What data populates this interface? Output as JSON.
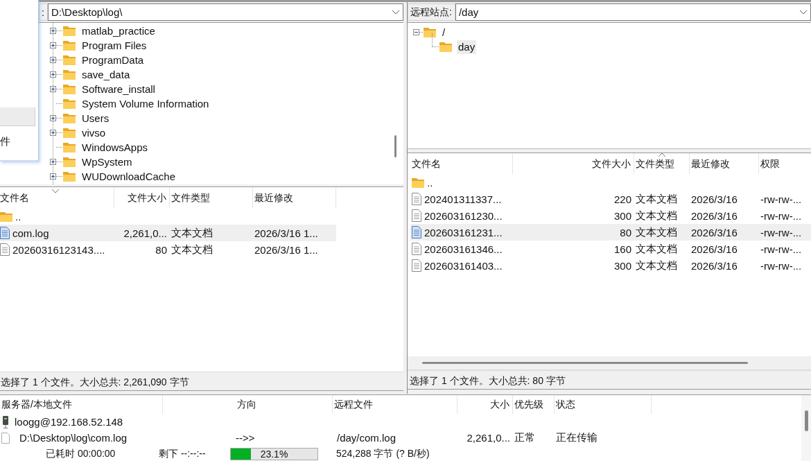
{
  "overlay_window": {
    "text": "件"
  },
  "local": {
    "path_label": ":",
    "path": "D:\\Desktop\\log\\",
    "tree": [
      {
        "name": "matlab_practice",
        "expandable": true
      },
      {
        "name": "Program Files",
        "expandable": true
      },
      {
        "name": "ProgramData",
        "expandable": true
      },
      {
        "name": "save_data",
        "expandable": true
      },
      {
        "name": "Software_install",
        "expandable": true
      },
      {
        "name": "System Volume Information",
        "expandable": false
      },
      {
        "name": "Users",
        "expandable": true
      },
      {
        "name": "vivso",
        "expandable": true
      },
      {
        "name": "WindowsApps",
        "expandable": false
      },
      {
        "name": "WpSystem",
        "expandable": true
      },
      {
        "name": "WUDownloadCache",
        "expandable": true
      }
    ],
    "sort_ascending": false,
    "columns": [
      {
        "label": "文件名",
        "sorted": true
      },
      {
        "label": "文件大小",
        "sorted": false
      },
      {
        "label": "文件类型",
        "sorted": false
      },
      {
        "label": "最近修改",
        "sorted": false
      }
    ],
    "files": [
      {
        "kind": "folder",
        "name": "..",
        "selected": false
      },
      {
        "kind": "file",
        "name": "com.log",
        "size": "2,261,0...",
        "type": "文本文档",
        "modified": "2026/3/16 1...",
        "selected": true
      },
      {
        "kind": "file",
        "name": "20260316123143....",
        "size": "80",
        "type": "文本文档",
        "modified": "2026/3/16 1...",
        "selected": false
      }
    ],
    "status": "选择了 1 个文件。大小总共: 2,261,090 字节"
  },
  "remote": {
    "path_label": "远程站点:",
    "path": "/day",
    "tree": [
      {
        "name": "/",
        "expanded": true,
        "selected": false,
        "children": [
          {
            "name": "day",
            "selected": true
          }
        ]
      }
    ],
    "sort_ascending": true,
    "columns": [
      {
        "label": "文件名",
        "sorted": false
      },
      {
        "label": "文件大小",
        "sorted": false
      },
      {
        "label": "文件类型",
        "sorted": true
      },
      {
        "label": "最近修改",
        "sorted": false
      },
      {
        "label": "权限",
        "sorted": false
      }
    ],
    "files": [
      {
        "kind": "folder",
        "name": "..",
        "selected": false
      },
      {
        "kind": "file",
        "name": "202401311337...",
        "size": "220",
        "type": "文本文档",
        "modified": "2026/3/16",
        "permissions": "-rw-rw-...",
        "selected": false
      },
      {
        "kind": "file",
        "name": "202603161230...",
        "size": "300",
        "type": "文本文档",
        "modified": "2026/3/16",
        "permissions": "-rw-rw-...",
        "selected": false
      },
      {
        "kind": "file",
        "name": "202603161231...",
        "size": "80",
        "type": "文本文档",
        "modified": "2026/3/16",
        "permissions": "-rw-rw-...",
        "selected": true
      },
      {
        "kind": "file",
        "name": "202603161346...",
        "size": "160",
        "type": "文本文档",
        "modified": "2026/3/16",
        "permissions": "-rw-rw-...",
        "selected": false
      },
      {
        "kind": "file",
        "name": "202603161403...",
        "size": "300",
        "type": "文本文档",
        "modified": "2026/3/16",
        "permissions": "-rw-rw-...",
        "selected": false
      }
    ],
    "status": "选择了 1 个文件。大小总共: 80 字节"
  },
  "queue": {
    "columns": [
      "服务器/本地文件",
      "方向",
      "远程文件",
      "大小",
      "优先级",
      "状态"
    ],
    "server": "loogg@192.168.52.148",
    "transfer": {
      "local_file": "D:\\Desktop\\log\\com.log",
      "direction": "-->>",
      "remote_file": "/day/com.log",
      "size": "2,261,0...",
      "priority": "正常",
      "status": "正在传输"
    },
    "progress": {
      "elapsed": "已耗时 00:00:00",
      "remaining": "剩下 --:--:--",
      "level": 0.231,
      "percent": "23.1%",
      "bytes": "524,288 字节 (? B/秒)"
    }
  }
}
